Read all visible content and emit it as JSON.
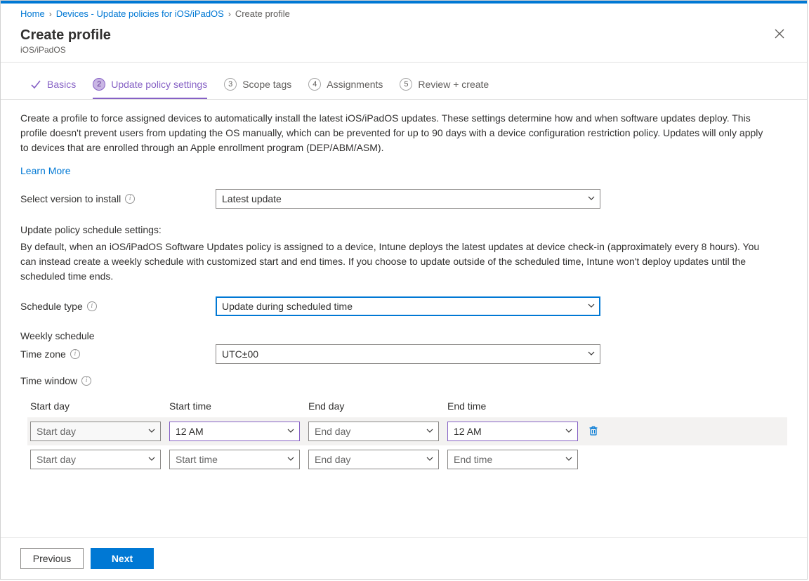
{
  "breadcrumb": {
    "items": [
      "Home",
      "Devices - Update policies for iOS/iPadOS",
      "Create profile"
    ]
  },
  "header": {
    "title": "Create profile",
    "subtitle": "iOS/iPadOS"
  },
  "tabs": [
    {
      "label": "Basics"
    },
    {
      "num": "2",
      "label": "Update policy settings"
    },
    {
      "num": "3",
      "label": "Scope tags"
    },
    {
      "num": "4",
      "label": "Assignments"
    },
    {
      "num": "5",
      "label": "Review + create"
    }
  ],
  "body": {
    "intro": "Create a profile to force assigned devices to automatically install the latest iOS/iPadOS updates. These settings determine how and when software updates deploy. This profile doesn't prevent users from updating the OS manually, which can be prevented for up to 90 days with a device configuration restriction policy. Updates will only apply to devices that are enrolled through an Apple enrollment program (DEP/ABM/ASM).",
    "learn_more": "Learn More",
    "version_label": "Select version to install",
    "version_value": "Latest update",
    "schedule_heading": "Update policy schedule settings:",
    "schedule_para": "By default, when an iOS/iPadOS Software Updates policy is assigned to a device, Intune deploys the latest updates at device check-in (approximately every 8 hours). You can instead create a weekly schedule with customized start and end times. If you choose to update outside of the scheduled time, Intune won't deploy updates until the scheduled time ends.",
    "schedule_type_label": "Schedule type",
    "schedule_type_value": "Update during scheduled time",
    "weekly_heading": "Weekly schedule",
    "timezone_label": "Time zone",
    "timezone_value": "UTC±00",
    "timewindow_label": "Time window",
    "columns": [
      "Start day",
      "Start time",
      "End day",
      "End time"
    ],
    "rows": [
      {
        "start_day": "Start day",
        "start_time": "12 AM",
        "end_day": "End day",
        "end_time": "12 AM",
        "deletable": true,
        "start_day_ph": true,
        "end_day_ph": true
      },
      {
        "start_day": "Start day",
        "start_time": "Start time",
        "end_day": "End day",
        "end_time": "End time",
        "deletable": false,
        "placeholder": true
      }
    ]
  },
  "footer": {
    "previous": "Previous",
    "next": "Next"
  }
}
